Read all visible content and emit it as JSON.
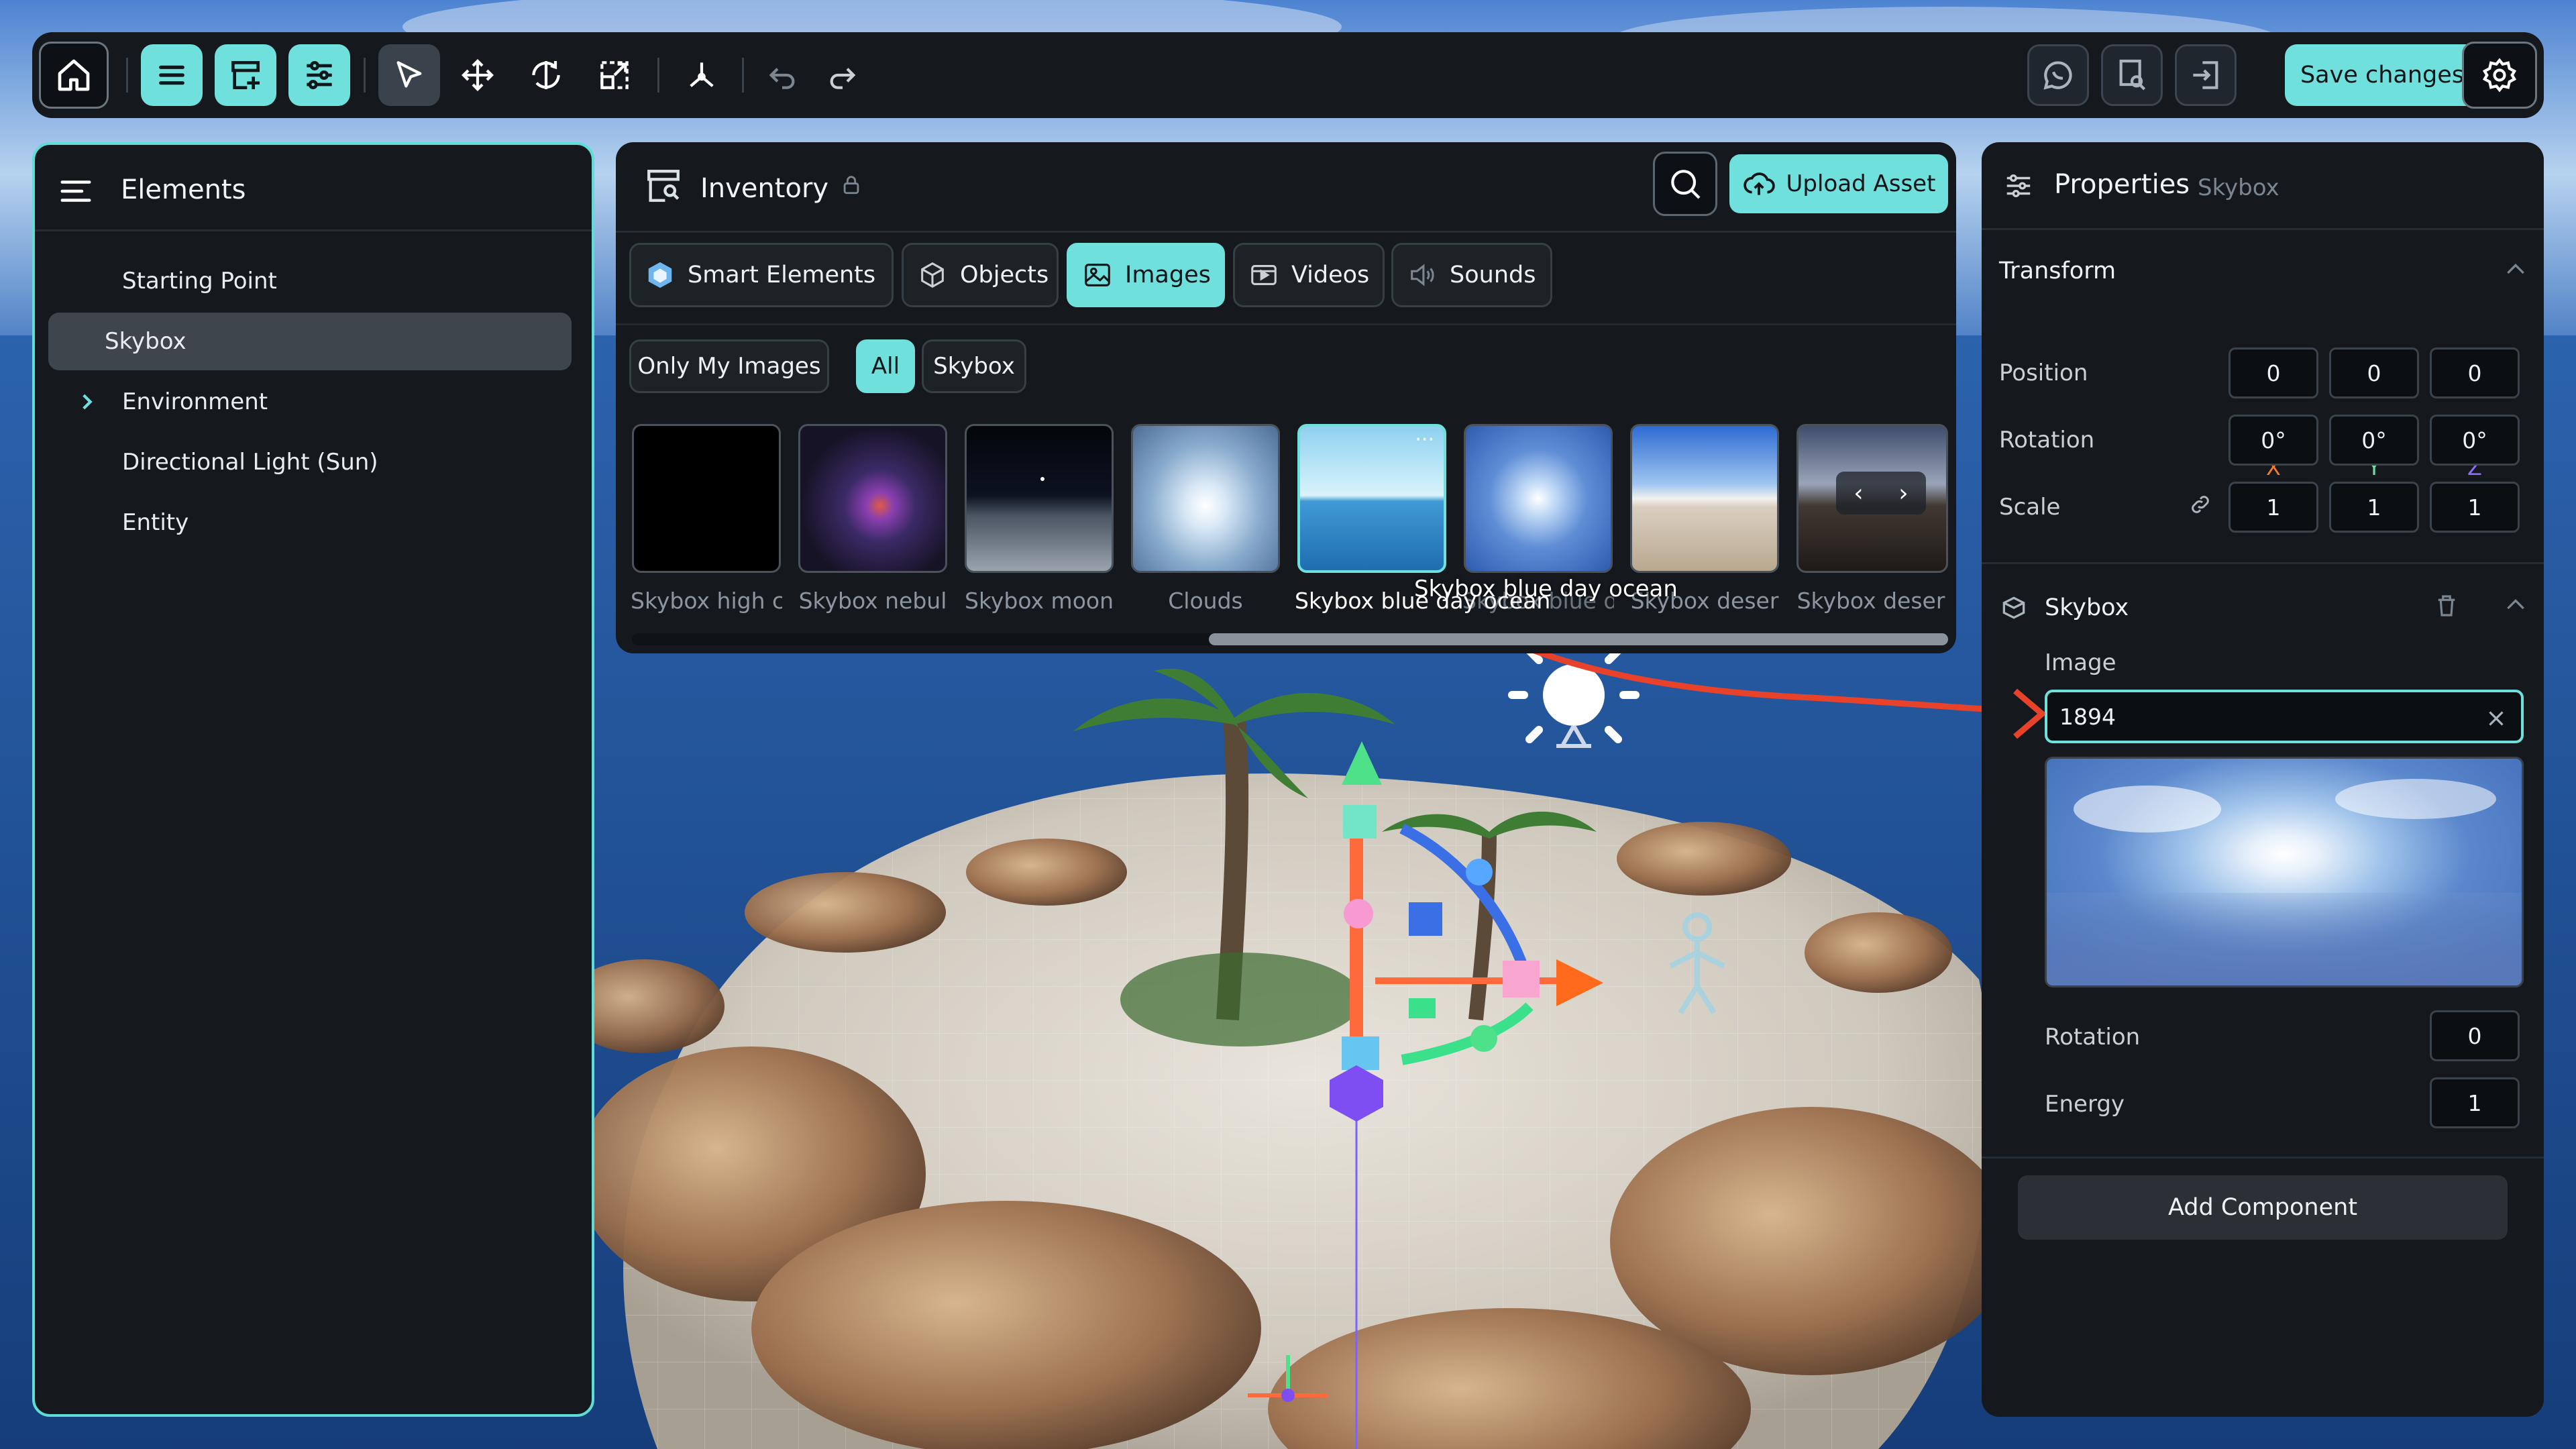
{
  "colors": {
    "accent": "#6fe0db",
    "panel": "#15191e",
    "arrow": "#e8432a",
    "axis_x": "#f57b2a",
    "axis_y": "#6fe0a2",
    "axis_z": "#8a6cff"
  },
  "toolbar": {
    "icons": [
      "home-icon",
      "menu-icon",
      "add-element-icon",
      "sliders-icon",
      "select-cursor-icon",
      "move-icon",
      "rotate-icon",
      "scale-icon",
      "pivot-icon",
      "undo-icon",
      "redo-icon",
      "chat-icon",
      "preview-icon",
      "exit-icon",
      "settings-icon"
    ],
    "save_label": "Save changes"
  },
  "elements_panel": {
    "title": "Elements",
    "items": [
      {
        "label": "Starting Point",
        "selected": false,
        "expandable": false
      },
      {
        "label": "Skybox",
        "selected": true,
        "expandable": false
      },
      {
        "label": "Environment",
        "selected": false,
        "expandable": true
      },
      {
        "label": "Directional Light (Sun)",
        "selected": false,
        "expandable": false
      },
      {
        "label": "Entity",
        "selected": false,
        "expandable": false
      }
    ]
  },
  "inventory": {
    "title": "Inventory",
    "upload_label": "Upload Asset",
    "tabs": [
      {
        "label": "Smart Elements",
        "icon": "smart-elements-icon"
      },
      {
        "label": "Objects",
        "icon": "cube-icon"
      },
      {
        "label": "Images",
        "icon": "image-icon",
        "active": true
      },
      {
        "label": "Videos",
        "icon": "video-icon"
      },
      {
        "label": "Sounds",
        "icon": "speaker-icon"
      }
    ],
    "filters": [
      {
        "label": "Only My Images"
      },
      {
        "label": "All",
        "active": true
      },
      {
        "label": "Skybox"
      }
    ],
    "thumbnails": [
      {
        "label": "Skybox high c"
      },
      {
        "label": "Skybox nebul"
      },
      {
        "label": "Skybox moon"
      },
      {
        "label": "Clouds"
      },
      {
        "label": "Skybox blue day ocean",
        "selected": true
      },
      {
        "label": "Skybox blue day ocean cloudy"
      },
      {
        "label": "Skybox deser"
      },
      {
        "label": "Skybox deser"
      }
    ],
    "tooltip": "Skybox blue day ocean",
    "scroll_fraction": 0.58
  },
  "properties": {
    "title": "Properties",
    "subtitle": "Skybox",
    "transform": {
      "title": "Transform",
      "axes": [
        "X",
        "Y",
        "Z"
      ],
      "rows": [
        {
          "label": "Position",
          "values": [
            "0",
            "0",
            "0"
          ]
        },
        {
          "label": "Rotation",
          "values": [
            "0°",
            "0°",
            "0°"
          ]
        },
        {
          "label": "Scale",
          "values": [
            "1",
            "1",
            "1"
          ]
        }
      ]
    },
    "skybox": {
      "title": "Skybox",
      "image_label": "Image",
      "image_value": "1894",
      "rotation_label": "Rotation",
      "rotation_value": "0",
      "energy_label": "Energy",
      "energy_value": "1"
    },
    "add_component_label": "Add Component"
  }
}
